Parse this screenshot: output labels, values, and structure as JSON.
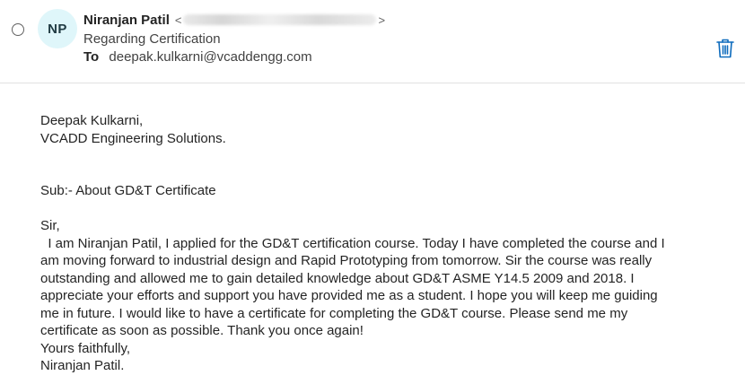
{
  "message": {
    "selected": false,
    "sender": {
      "initials": "NP",
      "name": "Niranjan Patil",
      "email_open": "<",
      "email_close": ">",
      "avatar_color": "#dff6fa"
    },
    "subject": "Regarding Certification",
    "to_label": "To",
    "to_address": "deepak.kulkarni@vcaddengg.com",
    "delete_icon": "trash-icon",
    "accent_color": "#0f6cbd"
  },
  "body": {
    "recipient_name": "Deepak Kulkarni,",
    "recipient_company": "VCADD Engineering Solutions.",
    "subject_line": "Sub:- About GD&T Certificate",
    "salutation": "Sir,",
    "paragraph_lines": [
      "  I am Niranjan Patil, I applied for the GD&T certification course. Today I have completed the course and I",
      "am moving forward to industrial design and Rapid Prototyping from tomorrow. Sir the course was really",
      "outstanding and allowed me to gain detailed knowledge about GD&T ASME Y14.5 2009 and 2018. I",
      "appreciate your efforts and support you have provided me as a student. I hope you will keep me guiding",
      "me in future. I would like to have a certificate for completing the GD&T course. Please send me my",
      "certificate as soon as possible. Thank you once again!"
    ],
    "closing": "Yours faithfully,",
    "signature": "Niranjan Patil."
  }
}
